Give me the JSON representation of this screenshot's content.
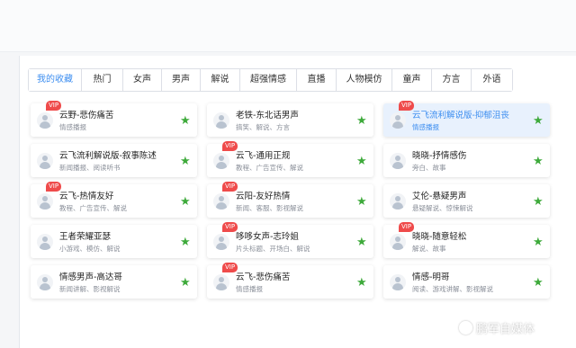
{
  "tabs": [
    {
      "label": "我的收藏",
      "active": true
    },
    {
      "label": "热门",
      "active": false
    },
    {
      "label": "女声",
      "active": false
    },
    {
      "label": "男声",
      "active": false
    },
    {
      "label": "解说",
      "active": false
    },
    {
      "label": "超强情感",
      "active": false
    },
    {
      "label": "直播",
      "active": false
    },
    {
      "label": "人物模仿",
      "active": false
    },
    {
      "label": "童声",
      "active": false
    },
    {
      "label": "方言",
      "active": false
    },
    {
      "label": "外语",
      "active": false
    }
  ],
  "voices": [
    {
      "name": "云野-悲伤痛苦",
      "tags": "情感播报",
      "vip": true,
      "selected": false
    },
    {
      "name": "老铁-东北话男声",
      "tags": "搞笑、解说、方言",
      "vip": false,
      "selected": false
    },
    {
      "name": "云飞流利解说版-抑郁沮丧",
      "tags": "情感播报",
      "vip": true,
      "selected": true
    },
    {
      "name": "云飞流利解说版-叙事陈述",
      "tags": "新闻播报、阅读听书",
      "vip": false,
      "selected": false
    },
    {
      "name": "云飞-通用正规",
      "tags": "教程、广告宣传、解说",
      "vip": true,
      "selected": false
    },
    {
      "name": "晓晓-抒情感伤",
      "tags": "旁白、故事",
      "vip": false,
      "selected": false
    },
    {
      "name": "云飞-热情友好",
      "tags": "教程、广告宣传、解说",
      "vip": true,
      "selected": false
    },
    {
      "name": "云阳-友好热情",
      "tags": "新闻、客服、影视解说",
      "vip": true,
      "selected": false
    },
    {
      "name": "艾伦-悬疑男声",
      "tags": "悬疑解说、惊悚解说",
      "vip": false,
      "selected": false
    },
    {
      "name": "王者荣耀亚瑟",
      "tags": "小游戏、模仿、解说",
      "vip": false,
      "selected": false
    },
    {
      "name": "哆哆女声-志玲姐",
      "tags": "片头标题、开场白、解说",
      "vip": true,
      "selected": false
    },
    {
      "name": "晓晓-随意轻松",
      "tags": "解说、故事",
      "vip": true,
      "selected": false
    },
    {
      "name": "情感男声-高达哥",
      "tags": "新闻讲解、影视解说",
      "vip": false,
      "selected": false
    },
    {
      "name": "云飞-悲伤痛苦",
      "tags": "情感播报",
      "vip": true,
      "selected": false
    },
    {
      "name": "情感-明哥",
      "tags": "阅读、游戏讲解、影视解说",
      "vip": false,
      "selected": false
    }
  ],
  "badge": {
    "vip_label": "VIP"
  },
  "icons": {
    "favorite": "star-icon",
    "avatar": "user-avatar-icon"
  },
  "colors": {
    "accent": "#3d8ef0",
    "vip": "#ef4b4b",
    "star": "#3eaa3b"
  },
  "watermark": {
    "text": "鹏军自媒体"
  }
}
